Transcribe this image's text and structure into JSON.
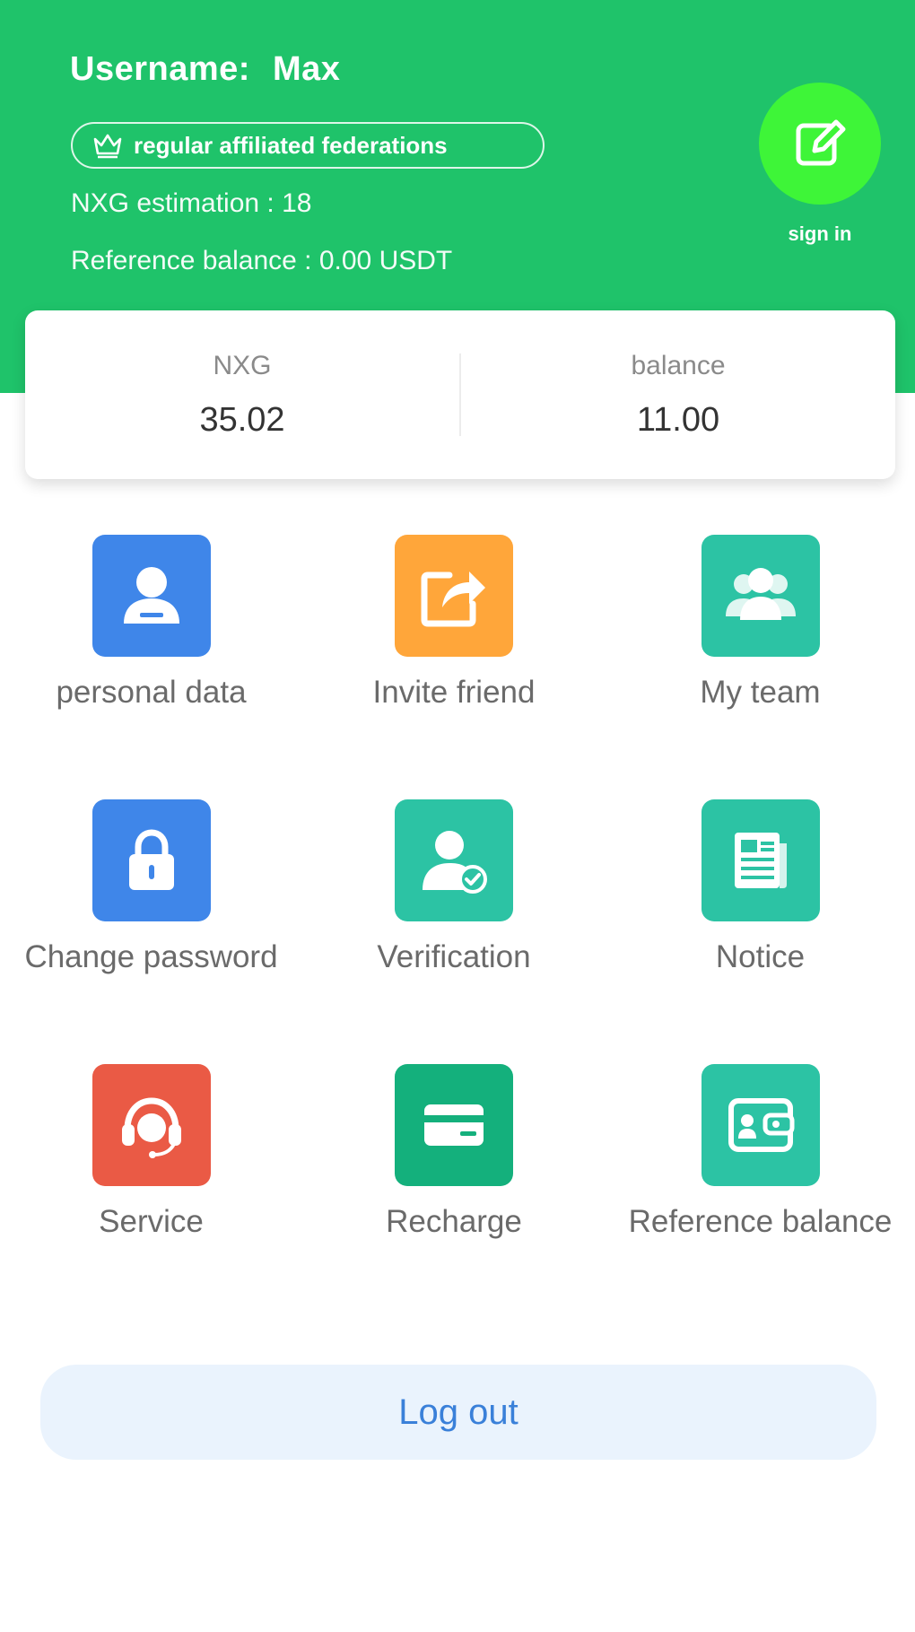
{
  "header": {
    "username_label": "Username:",
    "username_value": "Max",
    "level_badge": "regular affiliated federations",
    "nxg_estimation": "NXG estimation : 18",
    "reference_balance": "Reference balance : 0.00 USDT",
    "signin_label": "sign in",
    "background_color": "#1fc36a",
    "signin_color": "#3ef538"
  },
  "balances": [
    {
      "label": "NXG",
      "value": "35.02"
    },
    {
      "label": "balance",
      "value": "11.00"
    }
  ],
  "menu": [
    {
      "label": "personal data",
      "icon": "user-icon",
      "color": "#3f86e9"
    },
    {
      "label": "Invite friend",
      "icon": "share-icon",
      "color": "#ffa63a"
    },
    {
      "label": "My team",
      "icon": "team-icon",
      "color": "#2cc3a4"
    },
    {
      "label": "Change password",
      "icon": "lock-icon",
      "color": "#3f86e9"
    },
    {
      "label": "Verification",
      "icon": "verified-user-icon",
      "color": "#2cc3a4"
    },
    {
      "label": "Notice",
      "icon": "notice-icon",
      "color": "#2cc3a4"
    },
    {
      "label": "Service",
      "icon": "headset-icon",
      "color": "#ea5a45"
    },
    {
      "label": "Recharge",
      "icon": "card-icon",
      "color": "#14b07c"
    },
    {
      "label": "Reference balance",
      "icon": "wallet-icon",
      "color": "#2cc3a4"
    }
  ],
  "logout_label": "Log out"
}
